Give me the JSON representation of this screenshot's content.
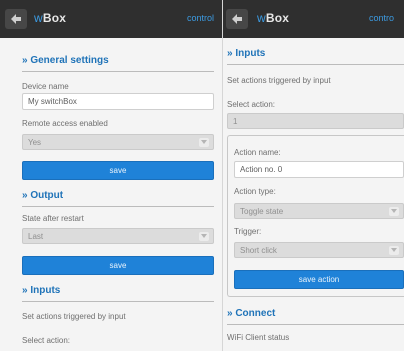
{
  "left": {
    "header": {
      "logo_w": "w",
      "logo_box": "Box",
      "link": "control"
    },
    "general": {
      "title": "» General settings",
      "device_name_label": "Device name",
      "device_name_value": "My switchBox",
      "remote_label": "Remote access enabled",
      "remote_value": "Yes",
      "save_label": "save"
    },
    "output": {
      "title": "» Output",
      "state_label": "State after restart",
      "state_value": "Last",
      "save_label": "save"
    },
    "inputs": {
      "title": "» Inputs",
      "desc": "Set actions triggered by input",
      "select_action_label": "Select action:"
    }
  },
  "right": {
    "header": {
      "logo_w": "w",
      "logo_box": "Box",
      "link": "contro"
    },
    "inputs": {
      "title": "» Inputs",
      "desc": "Set actions triggered by input",
      "select_action_label": "Select action:",
      "select_action_value": "1",
      "action_name_label": "Action name:",
      "action_name_value": "Action no. 0",
      "action_type_label": "Action type:",
      "action_type_value": "Toggle state",
      "trigger_label": "Trigger:",
      "trigger_value": "Short click",
      "save_action_label": "save action"
    },
    "connect": {
      "title": "» Connect",
      "wifi_label": "WiFi Client status"
    }
  }
}
